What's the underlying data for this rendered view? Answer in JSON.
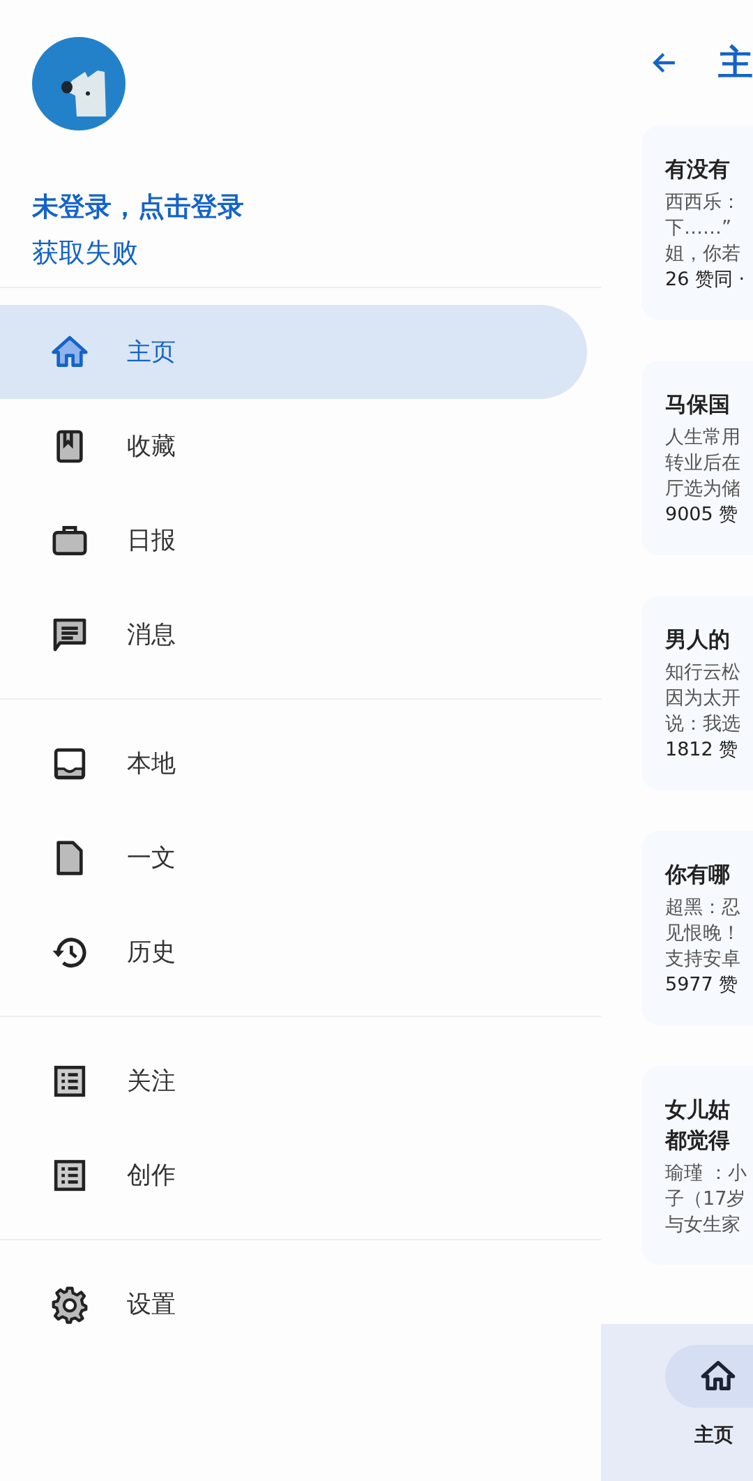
{
  "drawer": {
    "account": {
      "name": "未登录，点击登录",
      "status": "获取失败"
    },
    "groups": [
      [
        {
          "label": "主页",
          "kind": "home",
          "selected": true
        },
        {
          "label": "收藏",
          "kind": "bookmark",
          "selected": false
        },
        {
          "label": "日报",
          "kind": "briefcase",
          "selected": false
        },
        {
          "label": "消息",
          "kind": "message",
          "selected": false
        }
      ],
      [
        {
          "label": "本地",
          "kind": "inbox",
          "selected": false
        },
        {
          "label": "一文",
          "kind": "document",
          "selected": false
        },
        {
          "label": "历史",
          "kind": "history",
          "selected": false
        }
      ],
      [
        {
          "label": "关注",
          "kind": "list",
          "selected": false
        },
        {
          "label": "创作",
          "kind": "list",
          "selected": false
        }
      ],
      [
        {
          "label": "设置",
          "kind": "settings",
          "selected": false
        }
      ]
    ]
  },
  "main": {
    "title": "主",
    "cards": [
      {
        "title": [
          "有没有"
        ],
        "excerpt": [
          "西西乐：",
          "下……”",
          "姐，你若"
        ],
        "meta": "26 赞同 ·"
      },
      {
        "title": [
          "马保国"
        ],
        "excerpt": [
          "人生常用",
          "转业后在",
          "厅选为储"
        ],
        "meta": "9005 赞"
      },
      {
        "title": [
          "男人的"
        ],
        "excerpt": [
          "知行云松",
          "因为太开",
          "说：我选"
        ],
        "meta": "1812 赞"
      },
      {
        "title": [
          "你有哪"
        ],
        "excerpt": [
          "超黑：忍",
          "见恨晚！",
          "支持安卓"
        ],
        "meta": "5977 赞"
      },
      {
        "title": [
          "女儿姑",
          "都觉得"
        ],
        "excerpt": [
          "瑜瑾 ：小",
          "子（17岁",
          "与女生家"
        ]
      }
    ],
    "bottom_nav": [
      {
        "label": "主页",
        "selected": true
      }
    ]
  }
}
